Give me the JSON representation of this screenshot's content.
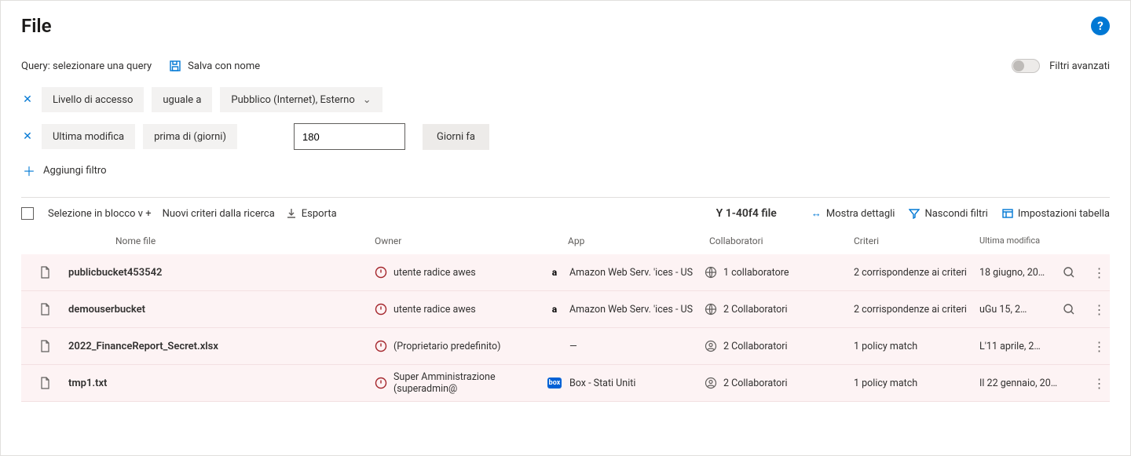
{
  "header": {
    "title": "File"
  },
  "query": {
    "label": "Query: selezionare una query",
    "save_as": "Salva con nome",
    "advanced_label": "Filtri avanzati",
    "filters": [
      {
        "field": "Livello di accesso",
        "op": "uguale a",
        "value": "Pubblico (Internet), Esterno"
      },
      {
        "field": "Ultima modifica",
        "op": "prima di (giorni)",
        "input": "180",
        "unit": "Giorni fa"
      }
    ],
    "add_filter": "Aggiungi filtro"
  },
  "toolbar": {
    "bulk": "Selezione in blocco v +",
    "new_policy": "Nuovi criteri dalla ricerca",
    "export": "Esporta",
    "count_prefix": "Y 1-40f4 file",
    "show_details": "Mostra dettagli",
    "hide_filters": "Nascondi filtri",
    "table_settings": "Impostazioni tabella"
  },
  "columns": {
    "name": "Nome file",
    "owner": "Owner",
    "app": "App",
    "collab": "Collaboratori",
    "policies": "Criteri",
    "modified": "Ultima modifica"
  },
  "rows": [
    {
      "name": "publicbucket453542",
      "owner": "utente radice awes",
      "app_icon": "aws",
      "app": "Amazon Web Serv. 'ices -   US",
      "collab_icon": "globe",
      "collab": "1 collaboratore",
      "policies": "2 corrispondenze ai criteri",
      "modified": "18 giugno, 20…",
      "search": true
    },
    {
      "name": "demouserbucket",
      "owner": "utente radice awes",
      "app_icon": "aws",
      "app": "Amazon Web Serv. 'ices -   US",
      "collab_icon": "globe",
      "collab": "2 Collaboratori",
      "policies": "2 corrispondenze ai criteri",
      "modified": "uGu 15, 2…",
      "search": true
    },
    {
      "name": "2022_FinanceReport_Secret.xlsx",
      "owner": "(Proprietario predefinito)",
      "app_icon": "none",
      "app": "—",
      "collab_icon": "user",
      "collab": "2 Collaboratori",
      "policies": "1 policy match",
      "modified": "L'11 aprile, 2…",
      "search": false
    },
    {
      "name": "tmp1.txt",
      "owner": "Super Amministrazione (superadmin@",
      "app_icon": "box",
      "app": "Box - Stati Uniti",
      "collab_icon": "user",
      "collab": "2 Collaboratori",
      "policies": "1 policy match",
      "modified": "Il 22 gennaio, 20…",
      "search": false
    }
  ]
}
